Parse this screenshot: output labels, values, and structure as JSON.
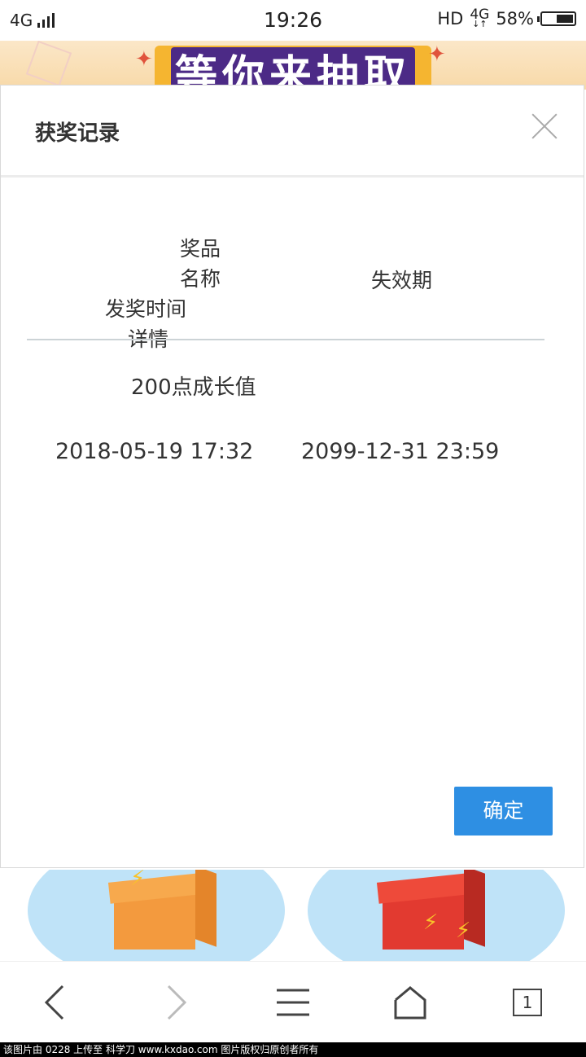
{
  "status_bar": {
    "network": "4G",
    "time": "19:26",
    "hd": "HD",
    "net_type": "4G",
    "battery_percent": "58%",
    "battery_level": 0.58
  },
  "banner": {
    "title": "等你来抽取"
  },
  "dialog": {
    "title": "获奖记录",
    "columns": {
      "prize_name": "奖品名称",
      "issue_time": "发奖时间",
      "details": "详情",
      "expiry": "失效期"
    },
    "rows": [
      {
        "prize": "200点成长值",
        "issue_time": "2018-05-19 17:32",
        "expiry": "2099-12-31 23:59"
      }
    ],
    "confirm_label": "确定"
  },
  "bottom_nav": {
    "tab_count": "1"
  },
  "watermark": "该图片由 0228 上传至 科学刀 www.kxdao.com 图片版权归原创者所有",
  "colors": {
    "accent": "#2e8fe3",
    "banner_purple": "#4c2a86",
    "banner_gold": "#f5b530"
  }
}
